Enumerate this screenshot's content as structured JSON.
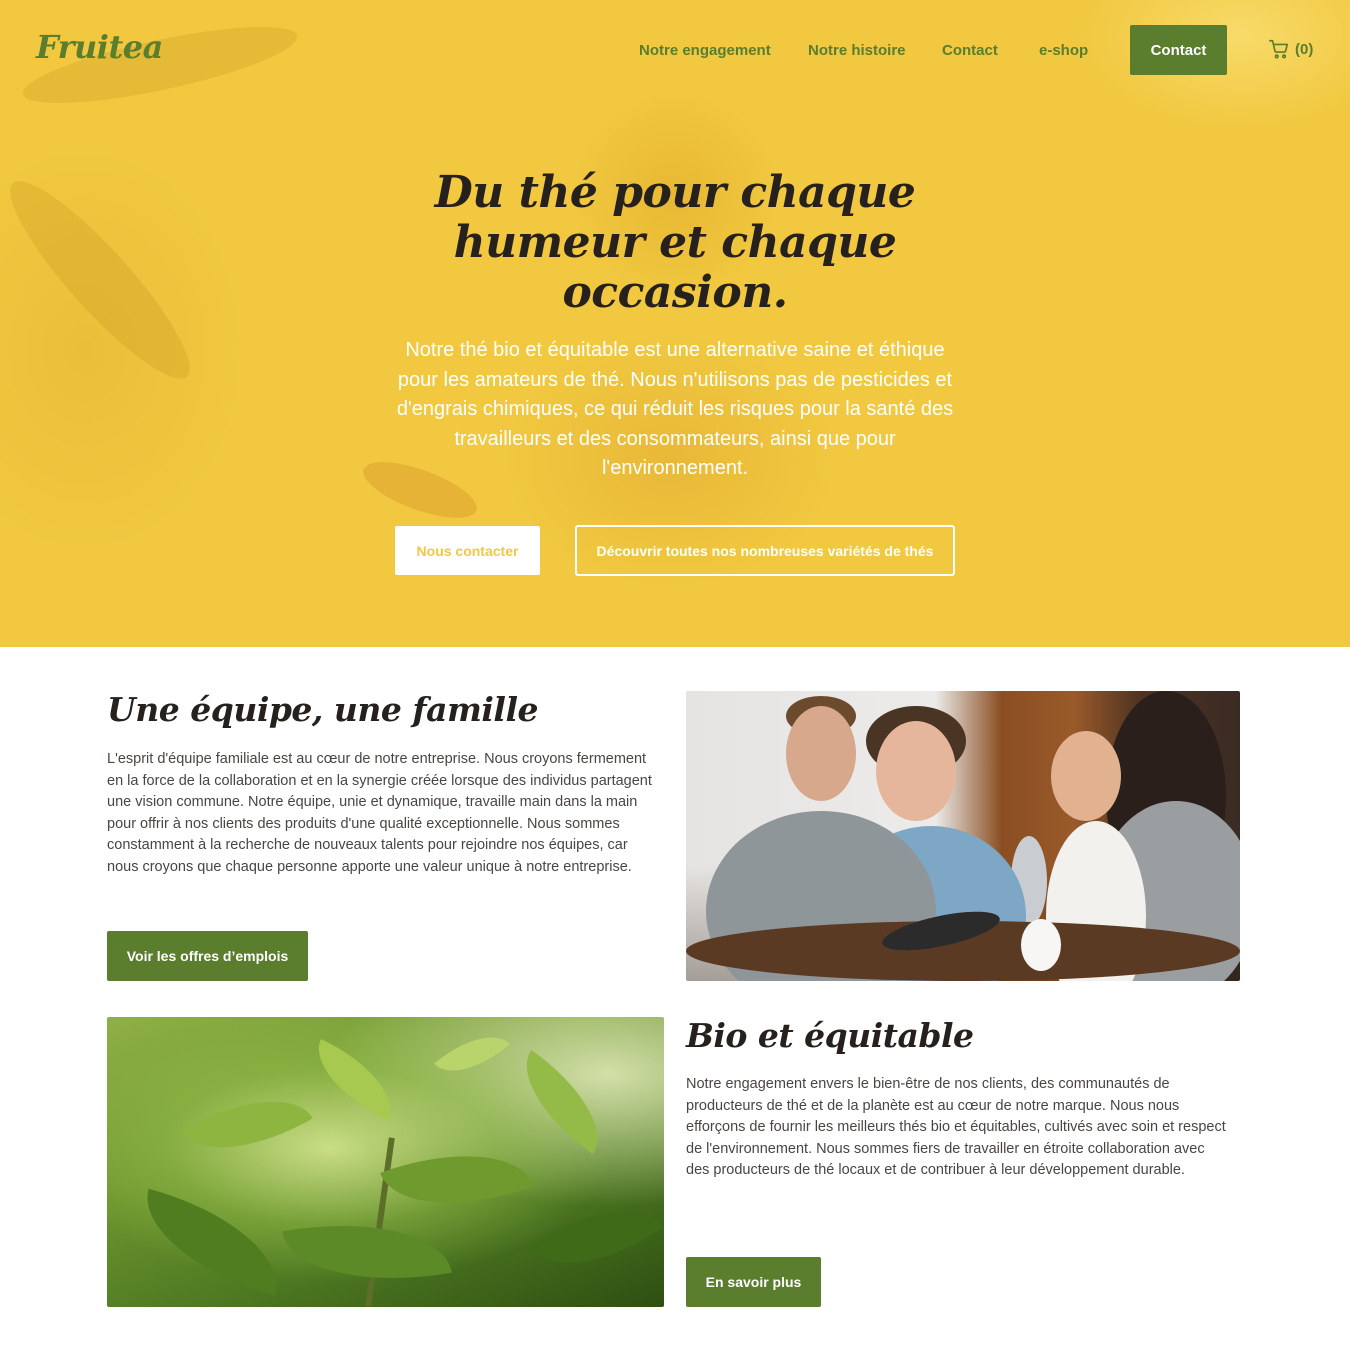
{
  "brand": {
    "logo": "Fruitea",
    "accent": "#5a7d2e",
    "hero_color": "#f1c840"
  },
  "nav": {
    "items": [
      {
        "label": "Notre engagement"
      },
      {
        "label": "Notre histoire"
      },
      {
        "label": "Contact"
      },
      {
        "label": "e-shop"
      }
    ],
    "cta_label": "Contact",
    "cart": {
      "icon": "cart-icon",
      "count": "(0)"
    }
  },
  "hero": {
    "title": "Du thé pour chaque humeur et chaque occasion.",
    "text": "Notre thé bio et équitable est une alternative saine et éthique pour les amateurs de thé. Nous n'utilisons pas de pesticides et d'engrais chimiques, ce qui réduit les risques pour la santé des travailleurs et des consommateurs, ainsi que pour l'environnement.",
    "primary_button": "Nous contacter",
    "secondary_button": "Découvrir toutes nos nombreuses variétés de thés"
  },
  "team": {
    "title": "Une équipe, une famille",
    "text": "L'esprit d'équipe familiale est au cœur de notre entreprise. Nous croyons fermement en la force de la collaboration et en la synergie créée lorsque des individus partagent une vision commune. Notre équipe, unie et dynamique, travaille main dans la main pour offrir à nos clients des produits d'une qualité exceptionnelle. Nous sommes constamment à la recherche de nouveaux talents pour rejoindre nos équipes, car nous croyons que chaque personne apporte une valeur unique à notre entreprise.",
    "button": "Voir les offres d’emplois"
  },
  "bio": {
    "title": "Bio et équitable",
    "text": "Notre engagement envers le bien-être de nos clients, des communautés de producteurs de thé et de la planète est au cœur de notre marque. Nous nous efforçons de fournir les meilleurs thés bio et équitables, cultivés avec soin et respect de l'environnement. Nous sommes fiers de travailler en étroite collaboration avec des producteurs de thé locaux et de contribuer à leur développement durable.",
    "button": "En savoir plus"
  }
}
